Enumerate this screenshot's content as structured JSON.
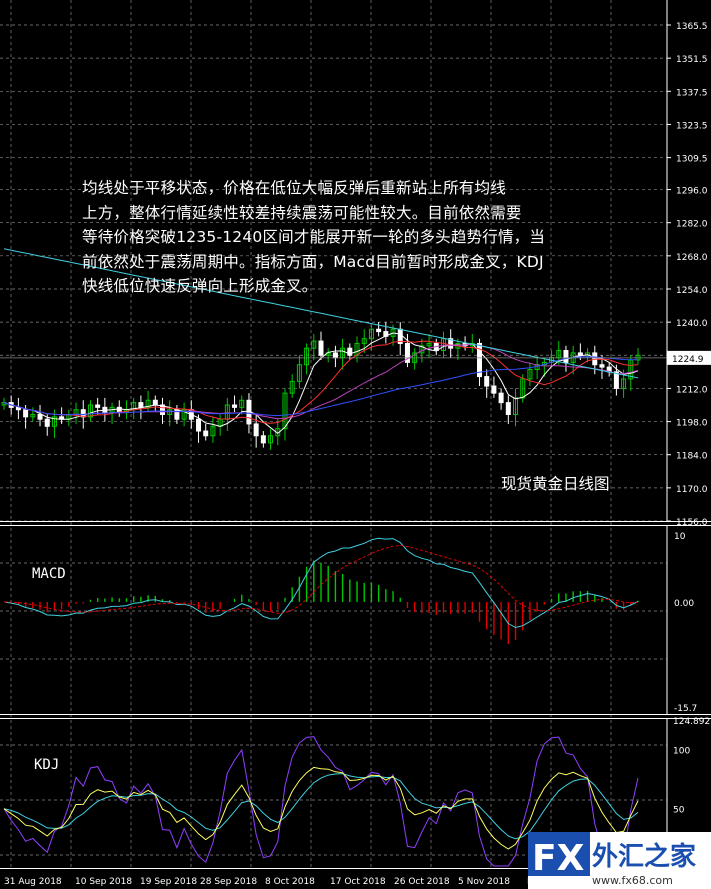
{
  "annotation": {
    "lines": [
      "均线处于平移状态，价格在低位大幅反弹后重新站上所有均线",
      "上方，整体行情延续性较差持续震荡可能性较大。目前依然需要",
      "等待价格突破1235-1240区间才能展开新一轮的多头趋势行情，当",
      "前依然处于震荡周期中。指标方面，Macd目前暂时形成金叉，KDJ",
      "快线低位快速反弹向上形成金叉。"
    ]
  },
  "caption": "现货黄金日线图",
  "logo": {
    "fx": "FX",
    "cn": "外汇之家",
    "site": "www.fx68.com"
  },
  "colors": {
    "background": "#000000",
    "grid": "#8a8a8a",
    "bull_candle": "#00c800",
    "bear_candle": "#ffffff",
    "ma_fast": "#ffffff",
    "ma_mid": "#ff3030",
    "ma_slow": "#c040c0",
    "ma_long": "#3050ff",
    "ma_longest": "#40d0e0",
    "macd_pos": "#00c800",
    "macd_neg": "#e00000",
    "macd_line": "#40d0e0",
    "signal_line": "#e00000",
    "k_line": "#ffff60",
    "d_line": "#40d0e0",
    "j_line": "#9040ff"
  },
  "chart_data": [
    {
      "type": "candlestick",
      "name": "price",
      "yaxis_ticks": [
        "1365.5",
        "1351.5",
        "1337.5",
        "1323.5",
        "1309.5",
        "1296.0",
        "1282.0",
        "1268.0",
        "1254.0",
        "1240.0",
        "1226.0",
        "1212.0",
        "1198.0",
        "1184.0",
        "1170.0",
        "1156.0"
      ],
      "ylim": [
        1156.0,
        1365.5
      ],
      "current_price": "1224.9",
      "x_ticks": [
        "31 Aug 2018",
        "10 Sep 2018",
        "19 Sep 2018",
        "28 Sep 2018",
        "8 Oct 2018",
        "17 Oct 2018",
        "26 Oct 2018",
        "5 Nov 2018",
        "Nov 2018"
      ],
      "closes": [
        1206,
        1204,
        1203,
        1200,
        1201,
        1199,
        1196,
        1200,
        1199,
        1201,
        1203,
        1200,
        1205,
        1204,
        1202,
        1204,
        1202,
        1203,
        1206,
        1204,
        1207,
        1205,
        1201,
        1203,
        1199,
        1203,
        1199,
        1194,
        1192,
        1196,
        1199,
        1205,
        1204,
        1207,
        1197,
        1192,
        1189,
        1192,
        1195,
        1210,
        1215,
        1222,
        1229,
        1232,
        1226,
        1227,
        1225,
        1229,
        1226,
        1231,
        1233,
        1237,
        1236,
        1234,
        1237,
        1231,
        1223,
        1227,
        1230,
        1231,
        1228,
        1233,
        1229,
        1231,
        1230,
        1231,
        1217,
        1213,
        1210,
        1206,
        1201,
        1208,
        1216,
        1220,
        1222,
        1223,
        1225,
        1228,
        1223,
        1227,
        1226,
        1227,
        1222,
        1221,
        1219,
        1212,
        1216,
        1224,
        1226
      ]
    },
    {
      "type": "bar",
      "name": "MACD",
      "label": "MACD",
      "yaxis_ticks": [
        "10",
        "0.00",
        "-15.7"
      ],
      "ylim": [
        -15.7,
        10
      ]
    },
    {
      "type": "line",
      "name": "KDJ",
      "label": "KDJ",
      "yaxis_ticks": [
        "124.8923",
        "100",
        "50"
      ],
      "ylim": [
        0,
        124.8923
      ]
    }
  ]
}
